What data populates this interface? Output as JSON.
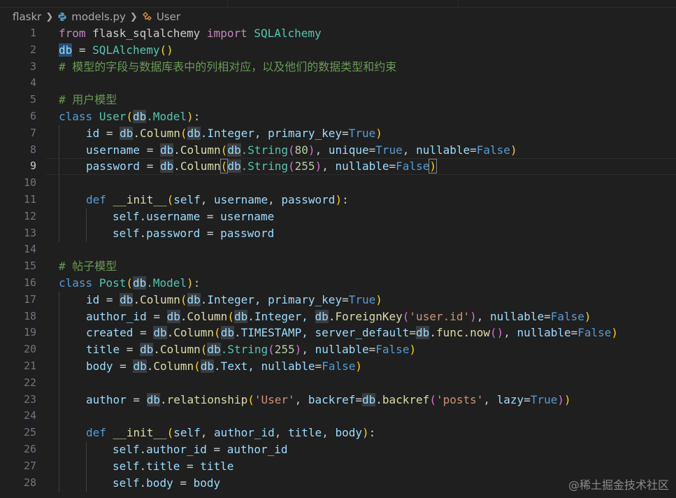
{
  "breadcrumb": {
    "folder": "flaskr",
    "file": "models.py",
    "symbol": "User"
  },
  "editor": {
    "active_line": 9,
    "lines": [
      {
        "n": "1"
      },
      {
        "n": "2"
      },
      {
        "n": "3"
      },
      {
        "n": "4"
      },
      {
        "n": "5"
      },
      {
        "n": "6"
      },
      {
        "n": "7"
      },
      {
        "n": "8"
      },
      {
        "n": "9"
      },
      {
        "n": "10"
      },
      {
        "n": "11"
      },
      {
        "n": "12"
      },
      {
        "n": "13"
      },
      {
        "n": "14"
      },
      {
        "n": "15"
      },
      {
        "n": "16"
      },
      {
        "n": "17"
      },
      {
        "n": "18"
      },
      {
        "n": "19"
      },
      {
        "n": "20"
      },
      {
        "n": "21"
      },
      {
        "n": "22"
      },
      {
        "n": "23"
      },
      {
        "n": "24"
      },
      {
        "n": "25"
      },
      {
        "n": "26"
      },
      {
        "n": "27"
      },
      {
        "n": "28"
      }
    ],
    "tokens": {
      "l1": [
        "from",
        " flask_sqlalchemy ",
        "import",
        " SQLAlchemy"
      ],
      "l2": [
        "db",
        " = ",
        "SQLAlchemy",
        "()",
        ""
      ],
      "l3": "# 模型的字段与数据库表中的列相对应，以及他们的数据类型和约束",
      "l5": "# 用户模型",
      "l6": [
        "class",
        " ",
        "User",
        "(",
        "db",
        ".Model",
        ")",
        ":"
      ],
      "l7": [
        "id",
        " = ",
        "db",
        ".Column",
        "(",
        "db",
        ".Integer, ",
        "primary_key",
        "=",
        "True",
        ")"
      ],
      "l8": [
        "username",
        " = ",
        "db",
        ".Column",
        "(",
        "db",
        ".String",
        "(",
        "80",
        ")",
        ", ",
        "unique",
        "=",
        "True",
        ", ",
        "nullable",
        "=",
        "False",
        ")"
      ],
      "l9": [
        "password",
        " = ",
        "db",
        ".Column",
        "(",
        "db",
        ".String",
        "(",
        "255",
        ")",
        ", ",
        "nullable",
        "=",
        "False",
        ")"
      ],
      "l11": [
        "def",
        " ",
        "__init__",
        "(",
        "self",
        ", ",
        "username",
        ", ",
        "password",
        ")",
        ":"
      ],
      "l12": [
        "self",
        ".",
        "username",
        " = ",
        "username"
      ],
      "l13": [
        "self",
        ".",
        "password",
        " = ",
        "password"
      ],
      "l15": "# 帖子模型",
      "l16": [
        "class",
        " ",
        "Post",
        "(",
        "db",
        ".Model",
        ")",
        ":"
      ],
      "l17": [
        "id",
        " = ",
        "db",
        ".Column",
        "(",
        "db",
        ".Integer, ",
        "primary_key",
        "=",
        "True",
        ")"
      ],
      "l18": [
        "author_id",
        " = ",
        "db",
        ".Column",
        "(",
        "db",
        ".Integer, ",
        "db",
        ".ForeignKey",
        "(",
        "'user.id'",
        ")",
        ", ",
        "nullable",
        "=",
        "False",
        ")"
      ],
      "l19": [
        "created",
        " = ",
        "db",
        ".Column",
        "(",
        "db",
        ".TIMESTAMP, ",
        "server_default",
        "=",
        "db",
        ".func.now",
        "()",
        ", ",
        "nullable",
        "=",
        "False",
        ")"
      ],
      "l20": [
        "title",
        " = ",
        "db",
        ".Column",
        "(",
        "db",
        ".String",
        "(",
        "255",
        ")",
        ", ",
        "nullable",
        "=",
        "False",
        ")"
      ],
      "l21": [
        "body",
        " = ",
        "db",
        ".Column",
        "(",
        "db",
        ".Text, ",
        "nullable",
        "=",
        "False",
        ")"
      ],
      "l23": [
        "author",
        " = ",
        "db",
        ".relationship",
        "(",
        "'User'",
        ", ",
        "backref",
        "=",
        "db",
        ".backref",
        "(",
        "'posts'",
        ", ",
        "lazy",
        "=",
        "True",
        ")",
        ")"
      ],
      "l25": [
        "def",
        " ",
        "__init__",
        "(",
        "self",
        ", ",
        "author_id",
        ", ",
        "title",
        ", ",
        "body",
        ")",
        ":"
      ],
      "l26": [
        "self",
        ".",
        "author_id",
        " = ",
        "author_id"
      ],
      "l27": [
        "self",
        ".",
        "title",
        " = ",
        "title"
      ],
      "l28": [
        "self",
        ".",
        "body",
        " = ",
        "body"
      ]
    }
  },
  "watermark": "@稀土掘金技术社区",
  "icons": {
    "breadcrumb_sep": "chevron-right-icon",
    "file": "python-file-icon",
    "symbol": "class-symbol-icon"
  }
}
